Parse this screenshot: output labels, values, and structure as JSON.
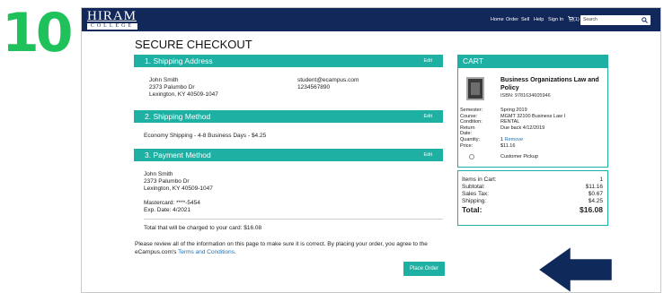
{
  "step_number": "10",
  "header": {
    "logo_main": "HIRAM",
    "logo_sub": "COLLEGE",
    "nav": [
      "Home",
      "Order",
      "Sell",
      "Help",
      "Sign In"
    ],
    "cart_count": "(1)",
    "search_placeholder": "Search"
  },
  "page_title": "SECURE CHECKOUT",
  "shipping_address": {
    "title": "1. Shipping Address",
    "edit": "Edit",
    "name": "John Smith",
    "street": "2373 Palumbo Dr",
    "city": "Lexington, KY 40509-1047",
    "email": "student@ecampus.com",
    "phone": "1234567890"
  },
  "shipping_method": {
    "title": "2. Shipping Method",
    "edit": "Edit",
    "text": "Economy Shipping - 4-8 Business Days - $4.25"
  },
  "payment_method": {
    "title": "3. Payment Method",
    "edit": "Edit",
    "name": "John Smith",
    "street": "2373 Palumbo Dr",
    "city": "Lexington, KY 40509-1047",
    "card": "Mastercard: ****-5454",
    "exp": "Exp. Date: 4/2021",
    "charge": "Total that will be charged to your card: $16.08"
  },
  "review": {
    "line1": "Please review all of the information on this page to make sure it is correct. By placing your order, you agree to the",
    "line2_prefix": "eCampus.com's ",
    "terms_link": "Terms and Conditions",
    "line2_suffix": ".",
    "place_order": "Place Order"
  },
  "cart": {
    "title": "CART",
    "item": {
      "title": "Business Organizations Law and Policy",
      "isbn": "ISBN: 9781634605946",
      "details": [
        {
          "label": "Semester:",
          "value": "Spring 2019"
        },
        {
          "label": "Course:",
          "value": "MGMT 32100 Business Law I"
        },
        {
          "label": "Condition:",
          "value": "RENTAL"
        },
        {
          "label": "Return",
          "value": "Due back 4/12/2019"
        },
        {
          "label": "Date:",
          "value": ""
        },
        {
          "label": "Quantity:",
          "value": "1"
        },
        {
          "label": "Price:",
          "value": "$11.16"
        }
      ],
      "remove": "Remove",
      "pickup": "Customer Pickup"
    },
    "summary": {
      "items_label": "Items in Cart:",
      "items_value": "1",
      "subtotal_label": "Subtotal:",
      "subtotal_value": "$11.16",
      "tax_label": "Sales Tax:",
      "tax_value": "$0.67",
      "shipping_label": "Shipping:",
      "shipping_value": "$4.25",
      "total_label": "Total:",
      "total_value": "$16.08"
    }
  },
  "colors": {
    "navy": "#12275a",
    "teal": "#1db0a3",
    "step_green": "#1fc25a",
    "arrow_navy": "#0f2a5a",
    "link_blue": "#1e6fb8"
  }
}
